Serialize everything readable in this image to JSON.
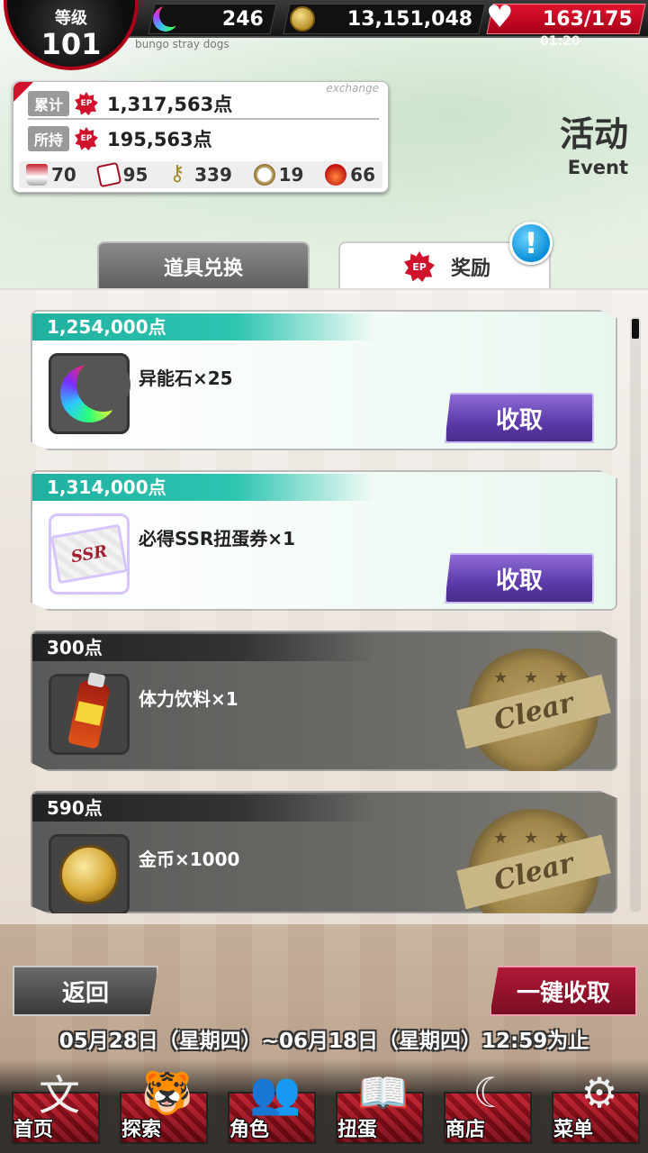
{
  "header": {
    "level_label": "等级",
    "level_value": "101",
    "game_subtitle": "bungo stray dogs",
    "gems": "246",
    "coins": "13,151,048",
    "stamina": "163/175",
    "stamina_timer": "01:20",
    "stamina_icon_text": "♥"
  },
  "ep_panel": {
    "exchange_tag": "exchange",
    "cumulative_label": "累计",
    "cumulative_value": "1,317,563点",
    "owned_label": "所持",
    "owned_value": "195,563点",
    "emblem_text": "EP",
    "items": [
      {
        "icon": "can-icon",
        "count": "70"
      },
      {
        "icon": "card-icon",
        "count": "95"
      },
      {
        "icon": "key-icon",
        "count": "339"
      },
      {
        "icon": "clock-icon",
        "count": "19"
      },
      {
        "icon": "crown-icon",
        "count": "66"
      }
    ]
  },
  "title": {
    "cn": "活动",
    "en": "Event"
  },
  "tabs": {
    "items_label": "道具兑换",
    "rewards_label": "奖励",
    "alert": "!"
  },
  "rewards": [
    {
      "points": "1,254,000点",
      "name": "异能石×25",
      "status": "claimable",
      "button": "收取"
    },
    {
      "points": "1,314,000点",
      "name": "必得SSR扭蛋券×1",
      "status": "claimable",
      "button": "收取"
    },
    {
      "points": "300点",
      "name": "体力饮料×1",
      "status": "cleared",
      "stamp": "Clear"
    },
    {
      "points": "590点",
      "name": "金币×1000",
      "status": "cleared",
      "stamp": "Clear"
    }
  ],
  "ticket_text": "SSR",
  "stamp_stars": "★ ★ ★",
  "controls": {
    "back": "返回",
    "claim_all": "一键收取",
    "date_range": "05月28日（星期四）~06月18日（星期四）12:59为止"
  },
  "nav": [
    {
      "label": "首页",
      "icon": "文"
    },
    {
      "label": "探索",
      "icon": "🐯"
    },
    {
      "label": "角色",
      "icon": "👥"
    },
    {
      "label": "扭蛋",
      "icon": "📖"
    },
    {
      "label": "商店",
      "icon": "☾"
    },
    {
      "label": "菜单",
      "icon": "⚙"
    }
  ],
  "colors": {
    "accent_red": "#d0122c",
    "claim_purple": "#5c3aa8",
    "points_teal": "#1fb0a0",
    "alert_blue": "#0a8fd6"
  }
}
